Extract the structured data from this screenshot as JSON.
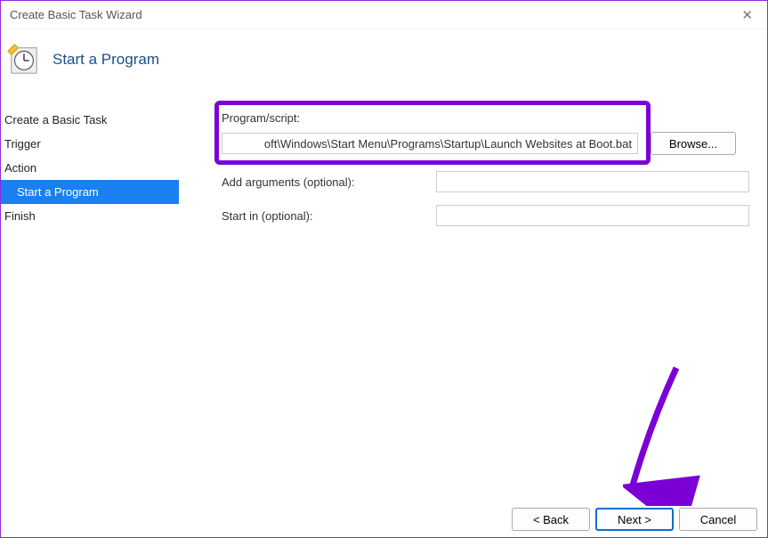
{
  "window": {
    "title": "Create Basic Task Wizard"
  },
  "header": {
    "title": "Start a Program"
  },
  "sidebar": {
    "items": [
      {
        "label": "Create a Basic Task",
        "selected": false
      },
      {
        "label": "Trigger",
        "selected": false
      },
      {
        "label": "Action",
        "selected": false
      },
      {
        "label": "Start a Program",
        "selected": true
      },
      {
        "label": "Finish",
        "selected": false
      }
    ]
  },
  "form": {
    "program_script_label": "Program/script:",
    "program_script_value": "oft\\Windows\\Start Menu\\Programs\\Startup\\Launch Websites at Boot.bat",
    "browse_label": "Browse...",
    "add_arguments_label": "Add arguments (optional):",
    "add_arguments_value": "",
    "start_in_label": "Start in (optional):",
    "start_in_value": ""
  },
  "footer": {
    "back_label": "< Back",
    "next_label": "Next >",
    "cancel_label": "Cancel"
  },
  "annotation": {
    "highlight_color": "#7b00d6"
  }
}
